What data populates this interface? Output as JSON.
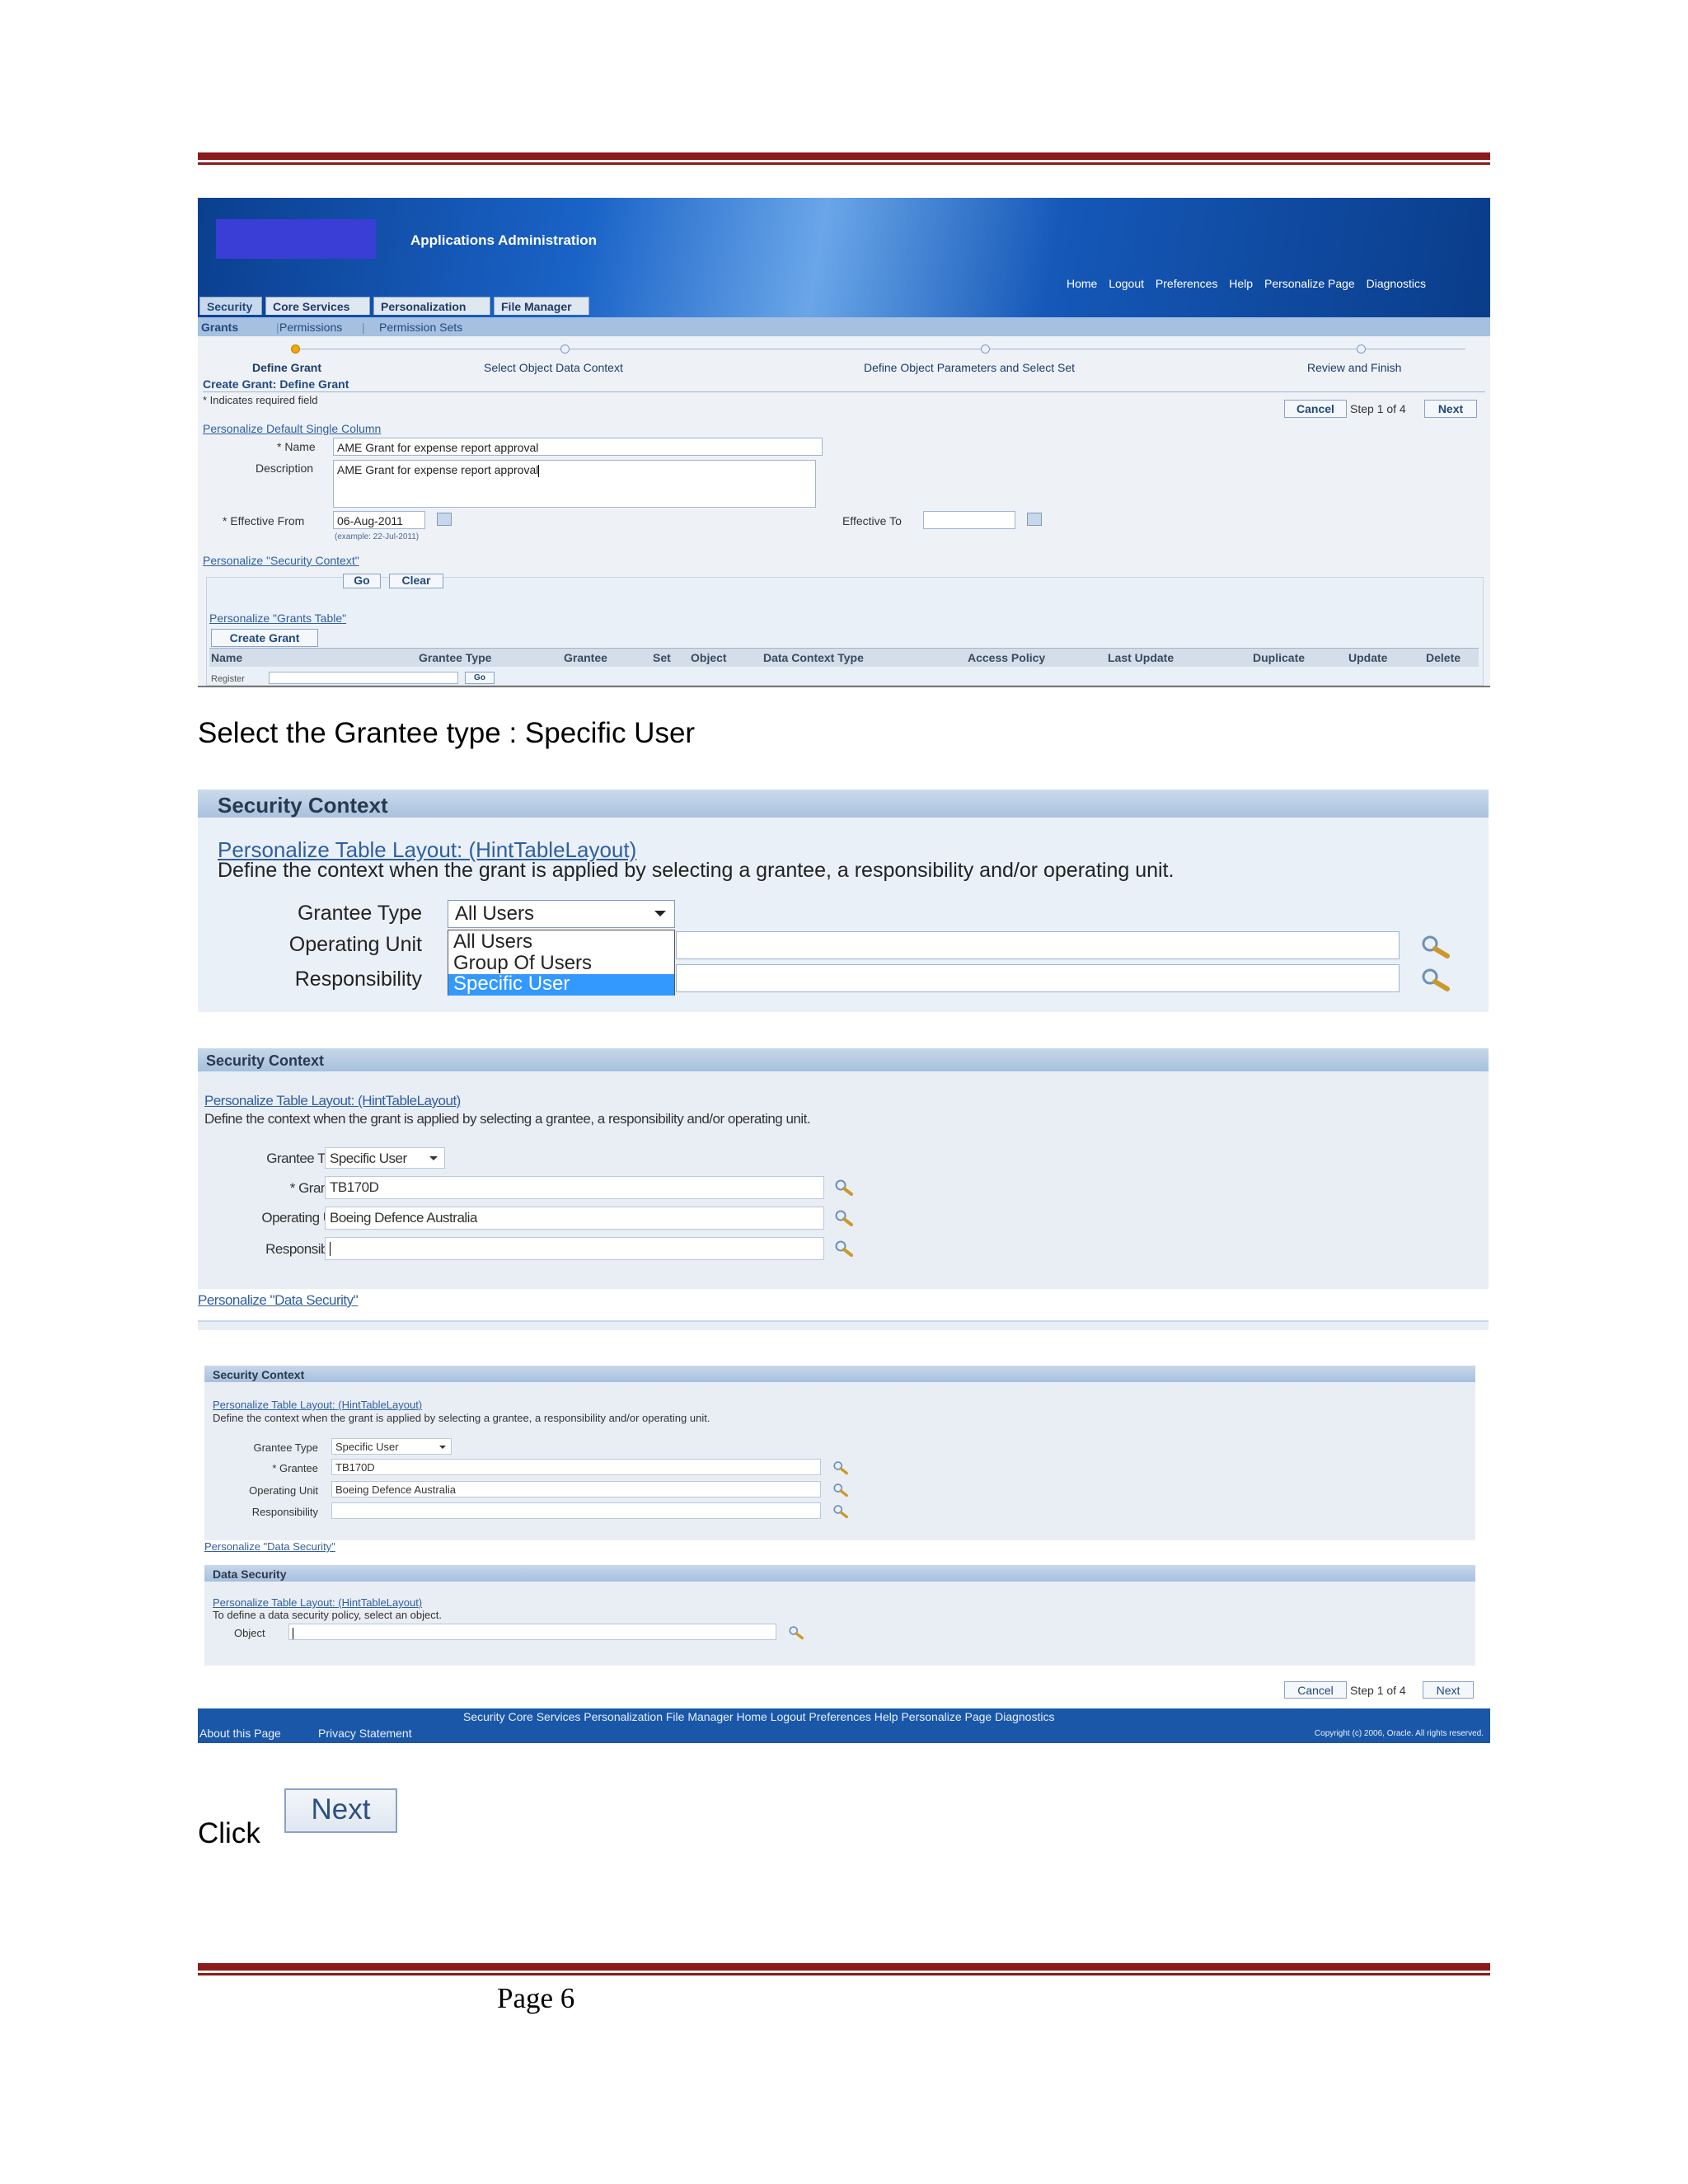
{
  "shot1": {
    "app_title": "Applications Administration",
    "global_links": [
      "Home",
      "Logout",
      "Preferences",
      "Help",
      "Personalize Page",
      "Diagnostics"
    ],
    "tabs": [
      "Security",
      "Core Services",
      "Personalization",
      "File Manager"
    ],
    "subtabs": [
      "Grants",
      "Permissions",
      "Permission Sets"
    ],
    "train_steps": [
      "Define Grant",
      "Select Object Data Context",
      "Define Object Parameters and Select Set",
      "Review and Finish"
    ],
    "page_heading": "Create Grant: Define Grant",
    "required_note": "* Indicates required field",
    "cancel_label": "Cancel",
    "step_text": "Step 1 of 4",
    "next_label": "Next",
    "personalize_default": "Personalize Default Single Column",
    "name_label": "* Name",
    "name_value": "AME Grant for expense report approval",
    "description_label": "Description",
    "description_value": "AME Grant for expense report approval",
    "effective_from_label": "* Effective From",
    "effective_from_value": "06-Aug-2011",
    "effective_from_example": "(example: 22-Jul-2011)",
    "effective_to_label": "Effective To",
    "effective_to_value": "",
    "personalize_security_context": "Personalize \"Security Context\"",
    "go_label": "Go",
    "clear_label": "Clear",
    "personalize_grants_table": "Personalize \"Grants Table\"",
    "create_grant_label": "Create Grant",
    "table_headers": [
      "Name",
      "Grantee Type",
      "Grantee",
      "Set",
      "Object",
      "Data Context Type",
      "Access Policy",
      "Last Update",
      "Duplicate",
      "Update",
      "Delete"
    ],
    "register_text": "Register",
    "go_small": "Go"
  },
  "caption1": "Select the Grantee type : Specific User",
  "shot2": {
    "section_title": "Security Context",
    "personalize_link": "Personalize Table Layout: (HintTableLayout)",
    "description": "Define the context when the grant is applied by selecting a grantee, a responsibility and/or operating unit.",
    "grantee_type_label": "Grantee Type",
    "operating_unit_label": "Operating Unit",
    "responsibility_label": "Responsibility",
    "grantee_type_value": "All Users",
    "options": [
      "All Users",
      "Group Of Users",
      "Specific User"
    ],
    "selected_option": "Specific User"
  },
  "shot3": {
    "section_title": "Security Context",
    "personalize_link": "Personalize Table Layout: (HintTableLayout)",
    "description": "Define the context when the grant is applied by selecting a grantee, a responsibility and/or operating unit.",
    "grantee_type_label": "Grantee Type",
    "grantee_type_value": "Specific User",
    "grantee_label": "* Grantee",
    "grantee_value": "TB170D",
    "operating_unit_label": "Operating Unit",
    "operating_unit_value": "Boeing Defence Australia",
    "responsibility_label": "Responsibility",
    "responsibility_value": "",
    "personalize_data_security": "Personalize \"Data Security\""
  },
  "shot4": {
    "section_title": "Security Context",
    "personalize_link": "Personalize Table Layout: (HintTableLayout)",
    "description": "Define the context when the grant is applied by selecting a grantee, a responsibility and/or operating unit.",
    "grantee_type_label": "Grantee Type",
    "grantee_type_value": "Specific User",
    "grantee_label": "* Grantee",
    "grantee_value": "TB170D",
    "operating_unit_label": "Operating Unit",
    "operating_unit_value": "Boeing Defence Australia",
    "responsibility_label": "Responsibility",
    "personalize_data_security": "Personalize \"Data Security\"",
    "data_security_title": "Data Security",
    "data_personalize_link": "Personalize Table Layout: (HintTableLayout)",
    "data_description": "To define a data security policy, select an object.",
    "object_label": "Object",
    "cancel_label": "Cancel",
    "step_text": "Step 1 of 4",
    "next_label": "Next",
    "footer_links": "Security   Core Services   Personalization   File Manager   Home   Logout   Preferences   Help   Personalize Page   Diagnostics",
    "about_page": "About this Page",
    "privacy": "Privacy Statement",
    "copyright": "Copyright (c) 2006, Oracle. All rights reserved."
  },
  "click_caption": "Click",
  "next_button_label": "Next",
  "page_number": "Page 6",
  "colors": {
    "rule": "#8b1a1a",
    "link": "#2f5f9f",
    "highlight": "#3399ff",
    "footer": "#1a57a8"
  }
}
